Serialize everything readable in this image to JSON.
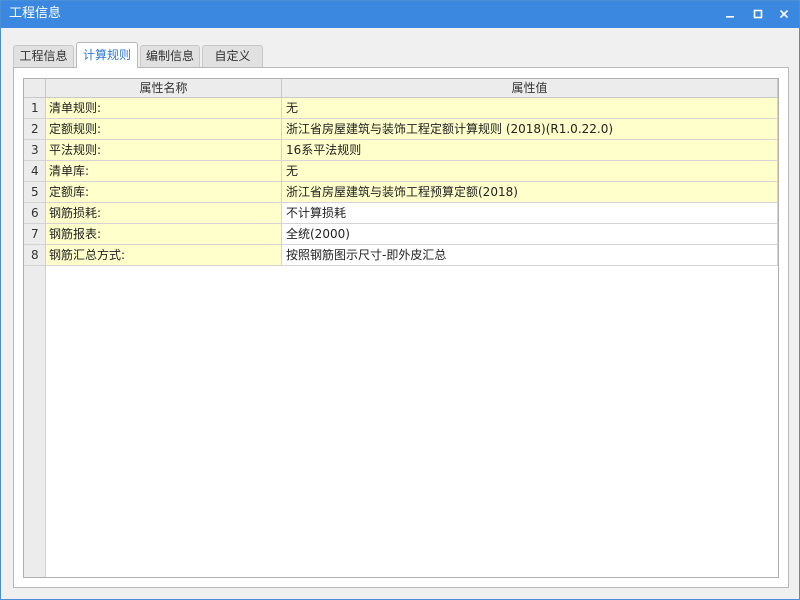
{
  "window": {
    "title": "工程信息"
  },
  "tabs": [
    {
      "label": "工程信息"
    },
    {
      "label": "计算规则"
    },
    {
      "label": "编制信息"
    },
    {
      "label": "自定义"
    }
  ],
  "grid": {
    "columns": {
      "name": "属性名称",
      "value": "属性值"
    },
    "rows": [
      {
        "num": "1",
        "name": "清单规则:",
        "value": "无"
      },
      {
        "num": "2",
        "name": "定额规则:",
        "value": "浙江省房屋建筑与装饰工程定额计算规则 (2018)(R1.0.22.0)"
      },
      {
        "num": "3",
        "name": "平法规则:",
        "value": "16系平法规则"
      },
      {
        "num": "4",
        "name": "清单库:",
        "value": "无"
      },
      {
        "num": "5",
        "name": "定额库:",
        "value": "浙江省房屋建筑与装饰工程预算定额(2018)"
      },
      {
        "num": "6",
        "name": "钢筋损耗:",
        "value": "不计算损耗"
      },
      {
        "num": "7",
        "name": "钢筋报表:",
        "value": "全统(2000)"
      },
      {
        "num": "8",
        "name": "钢筋汇总方式:",
        "value": "按照钢筋图示尺寸-即外皮汇总"
      }
    ]
  },
  "colors": {
    "titlebar": "#3a88e0",
    "highlight": "#ffffcc",
    "active_tab_text": "#2f7ad5"
  },
  "icons": {
    "minimize": "minimize-icon",
    "maximize": "maximize-icon",
    "close": "close-icon"
  }
}
